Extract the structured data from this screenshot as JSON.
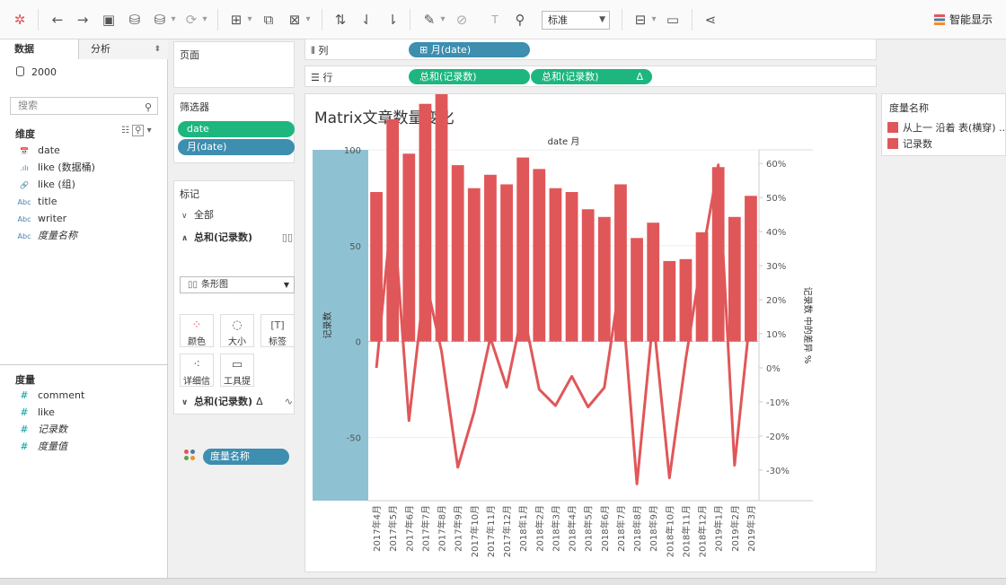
{
  "toolbar": {
    "buttons": [
      "tableau-logo-icon",
      "undo-icon",
      "redo-icon",
      "save-icon",
      "new-datasource-icon",
      "pause-updates-icon",
      "refresh-icon",
      "new-worksheet-icon",
      "duplicate-sheet-icon",
      "clear-sheet-icon",
      "swap-axes-icon",
      "sort-ascending-icon",
      "sort-descending-icon",
      "highlight-icon",
      "group-icon",
      "show-labels-icon",
      "fix-axes-icon",
      "presentation-mode-icon",
      "share-icon"
    ],
    "view_size": "标准",
    "show_me": "智能显示"
  },
  "left_pane": {
    "tabs": {
      "data": "数据",
      "analytics": "分析"
    },
    "datasource": "2000",
    "search_placeholder": "搜索",
    "dimensions_header": "维度",
    "dimensions": [
      {
        "icon": "date-icon",
        "glyph": "📅",
        "name": "date"
      },
      {
        "icon": "bin-icon",
        "glyph": ".ılı",
        "name": "like (数据桶)"
      },
      {
        "icon": "group-icon",
        "glyph": "🔗",
        "name": "like (组)"
      },
      {
        "icon": "string-icon",
        "glyph": "Abc",
        "name": "title"
      },
      {
        "icon": "string-icon",
        "glyph": "Abc",
        "name": "writer"
      },
      {
        "icon": "string-icon",
        "glyph": "Abc",
        "name": "度量名称"
      }
    ],
    "measures_header": "度量",
    "measures": [
      {
        "icon": "number-icon",
        "name": "comment"
      },
      {
        "icon": "number-icon",
        "name": "like"
      },
      {
        "icon": "number-icon",
        "name": "记录数"
      },
      {
        "icon": "number-icon",
        "name": "度量值"
      }
    ]
  },
  "pages": {
    "label": "页面"
  },
  "filters": {
    "label": "筛选器",
    "items": [
      "date",
      "月(date)"
    ]
  },
  "marks": {
    "label": "标记",
    "all": "全部",
    "sum_records": "总和(记录数)",
    "mark_type": "条形图",
    "buttons": [
      "颜色",
      "大小",
      "标签",
      "详细信息",
      "工具提示"
    ],
    "color_field": "度量名称",
    "sum_records_delta": "总和(记录数)"
  },
  "shelves": {
    "columns_label": "列",
    "rows_label": "行",
    "columns_pill": "月(date)",
    "rows_pill_1": "总和(记录数)",
    "rows_pill_2": "总和(记录数)"
  },
  "view": {
    "title": "Matrix文章数量变化"
  },
  "legend": {
    "title": "度量名称",
    "items": [
      "从上一 沿着 表(横穿) ..",
      "记录数"
    ],
    "color": "#e05759"
  },
  "chart_data": {
    "type": "bar",
    "title": "Matrix文章数量变化",
    "header": "date 月",
    "categories": [
      "2017年4月",
      "2017年5月",
      "2017年6月",
      "2017年7月",
      "2017年8月",
      "2017年9月",
      "2017年10月",
      "2017年11月",
      "2017年12月",
      "2018年1月",
      "2018年2月",
      "2018年3月",
      "2018年4月",
      "2018年5月",
      "2018年6月",
      "2018年7月",
      "2018年8月",
      "2018年9月",
      "2018年10月",
      "2018年11月",
      "2018年12月",
      "2019年1月",
      "2019年2月",
      "2019年3月"
    ],
    "series": [
      {
        "name": "记录数",
        "type": "bar",
        "axis": "left",
        "values": [
          78,
          116,
          98,
          124,
          130,
          92,
          80,
          87,
          82,
          96,
          90,
          80,
          78,
          69,
          65,
          82,
          54,
          62,
          42,
          43,
          57,
          91,
          65,
          76
        ]
      },
      {
        "name": "从上一 沿着 表(横穿) ..",
        "type": "line",
        "axis": "right",
        "values": [
          0,
          48.7,
          -15.5,
          26.5,
          4.8,
          -29.2,
          -13,
          8.8,
          -5.7,
          17.1,
          -6.3,
          -11.1,
          -2.5,
          -11.5,
          -5.8,
          26.2,
          -34.1,
          14.8,
          -32.3,
          2.4,
          32.6,
          59.6,
          -28.6,
          16.9
        ]
      }
    ],
    "ylabel": "记录数",
    "y2label": "记录数 中的差异 %",
    "ylim": [
      -83,
      100
    ],
    "y_ticks": [
      "100",
      "50",
      "0",
      "-50"
    ],
    "y2lim": [
      -39,
      64
    ],
    "y2_ticks": [
      "60%",
      "50%",
      "40%",
      "30%",
      "20%",
      "10%",
      "0%",
      "-10%",
      "-20%",
      "-30%"
    ],
    "color": "#e05759",
    "highlight_color": "#8ec2d3"
  }
}
